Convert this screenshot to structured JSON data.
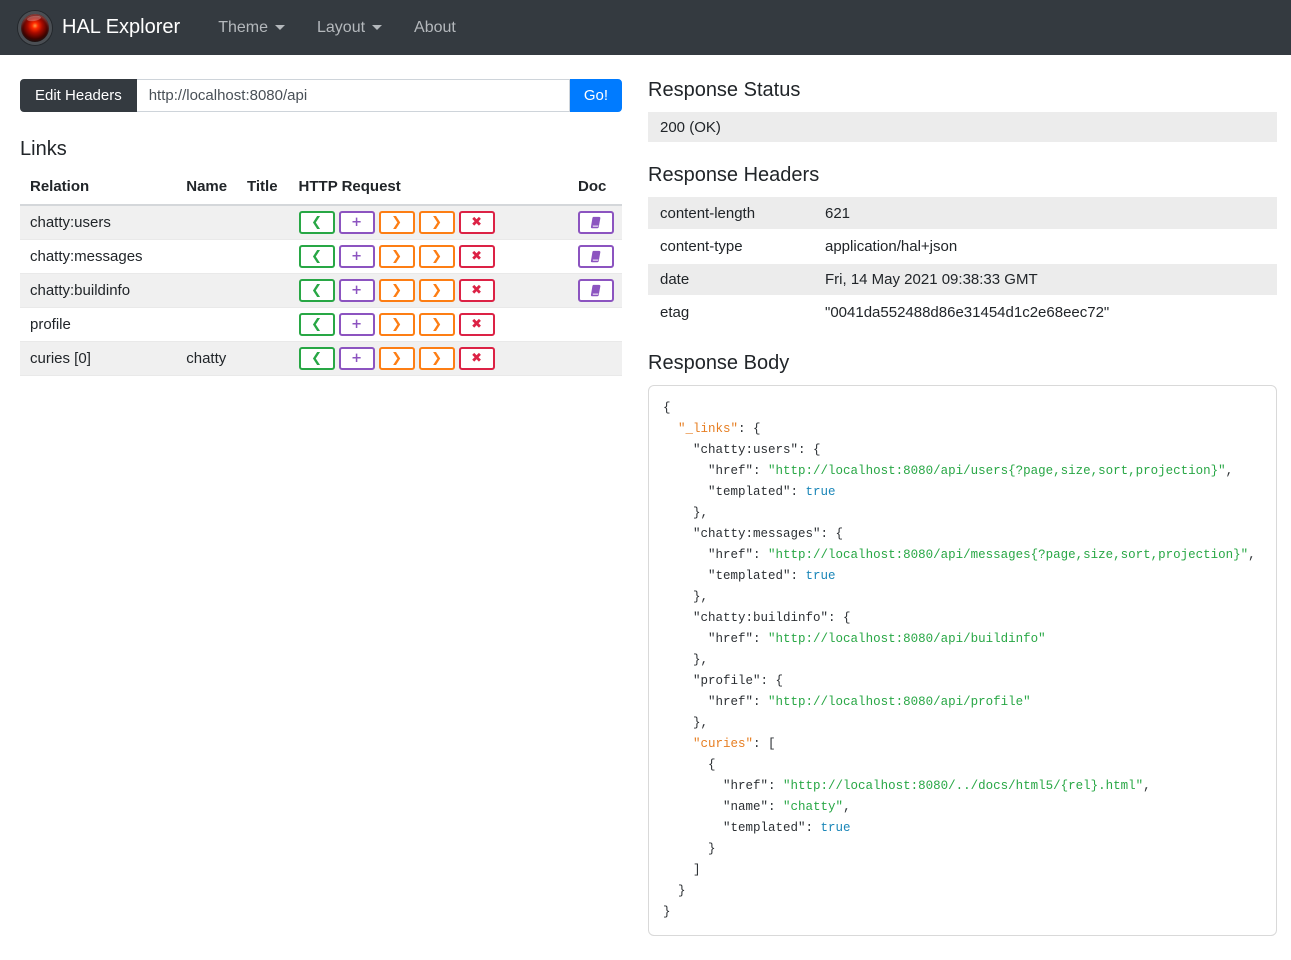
{
  "navbar": {
    "brand": "HAL Explorer",
    "items": [
      {
        "label": "Theme",
        "dropdown": true
      },
      {
        "label": "Layout",
        "dropdown": true
      },
      {
        "label": "About",
        "dropdown": false
      }
    ]
  },
  "address_bar": {
    "edit_headers_label": "Edit Headers",
    "url_value": "http://localhost:8080/api",
    "go_label": "Go!"
  },
  "links_section": {
    "title": "Links",
    "columns": [
      "Relation",
      "Name",
      "Title",
      "HTTP Request",
      "Doc"
    ],
    "http_request_buttons": [
      {
        "method": "get",
        "glyph": "❮",
        "color": "#28a745"
      },
      {
        "method": "post",
        "glyph": "+",
        "color": "#8c54c0"
      },
      {
        "method": "put",
        "glyph": "❯",
        "color": "#fd7e14"
      },
      {
        "method": "patch",
        "glyph": "❯",
        "color": "#fd7e14"
      },
      {
        "method": "delete",
        "glyph": "✖",
        "color": "#dc2245"
      }
    ],
    "doc_button_color": "#8c54c0",
    "rows": [
      {
        "relation": "chatty:users",
        "name": "",
        "title": "",
        "doc": true
      },
      {
        "relation": "chatty:messages",
        "name": "",
        "title": "",
        "doc": true
      },
      {
        "relation": "chatty:buildinfo",
        "name": "",
        "title": "",
        "doc": true
      },
      {
        "relation": "profile",
        "name": "",
        "title": "",
        "doc": false
      },
      {
        "relation": "curies [0]",
        "name": "chatty",
        "title": "",
        "doc": false
      }
    ]
  },
  "response_status": {
    "title": "Response Status",
    "value": "200 (OK)"
  },
  "response_headers": {
    "title": "Response Headers",
    "rows": [
      {
        "key": "content-length",
        "value": "621"
      },
      {
        "key": "content-type",
        "value": "application/hal+json"
      },
      {
        "key": "date",
        "value": "Fri, 14 May 2021 09:38:33 GMT"
      },
      {
        "key": "etag",
        "value": "\"0041da552488d86e31454d1c2e68eec72\""
      }
    ]
  },
  "response_body": {
    "title": "Response Body",
    "syntax_colors": {
      "key": "#2b2f33",
      "hal_key": "#e67e22",
      "string": "#28a745",
      "literal": "#1a86b8"
    },
    "lines": [
      {
        "i": 0,
        "t": [
          [
            "p",
            "{"
          ]
        ]
      },
      {
        "i": 2,
        "t": [
          [
            "h",
            "\"_links\""
          ],
          [
            "p",
            ": {"
          ]
        ]
      },
      {
        "i": 4,
        "t": [
          [
            "k",
            "\"chatty:users\""
          ],
          [
            "p",
            ": {"
          ]
        ]
      },
      {
        "i": 6,
        "t": [
          [
            "k",
            "\"href\""
          ],
          [
            "p",
            ": "
          ],
          [
            "s",
            "\"http://localhost:8080/api/users{?page,size,sort,projection}\""
          ],
          [
            "p",
            ","
          ]
        ]
      },
      {
        "i": 6,
        "t": [
          [
            "k",
            "\"templated\""
          ],
          [
            "p",
            ": "
          ],
          [
            "b",
            "true"
          ]
        ]
      },
      {
        "i": 4,
        "t": [
          [
            "p",
            "},"
          ]
        ]
      },
      {
        "i": 4,
        "t": [
          [
            "k",
            "\"chatty:messages\""
          ],
          [
            "p",
            ": {"
          ]
        ]
      },
      {
        "i": 6,
        "t": [
          [
            "k",
            "\"href\""
          ],
          [
            "p",
            ": "
          ],
          [
            "s",
            "\"http://localhost:8080/api/messages{?page,size,sort,projection}\""
          ],
          [
            "p",
            ","
          ]
        ]
      },
      {
        "i": 6,
        "t": [
          [
            "k",
            "\"templated\""
          ],
          [
            "p",
            ": "
          ],
          [
            "b",
            "true"
          ]
        ]
      },
      {
        "i": 4,
        "t": [
          [
            "p",
            "},"
          ]
        ]
      },
      {
        "i": 4,
        "t": [
          [
            "k",
            "\"chatty:buildinfo\""
          ],
          [
            "p",
            ": {"
          ]
        ]
      },
      {
        "i": 6,
        "t": [
          [
            "k",
            "\"href\""
          ],
          [
            "p",
            ": "
          ],
          [
            "s",
            "\"http://localhost:8080/api/buildinfo\""
          ]
        ]
      },
      {
        "i": 4,
        "t": [
          [
            "p",
            "},"
          ]
        ]
      },
      {
        "i": 4,
        "t": [
          [
            "k",
            "\"profile\""
          ],
          [
            "p",
            ": {"
          ]
        ]
      },
      {
        "i": 6,
        "t": [
          [
            "k",
            "\"href\""
          ],
          [
            "p",
            ": "
          ],
          [
            "s",
            "\"http://localhost:8080/api/profile\""
          ]
        ]
      },
      {
        "i": 4,
        "t": [
          [
            "p",
            "},"
          ]
        ]
      },
      {
        "i": 4,
        "t": [
          [
            "h",
            "\"curies\""
          ],
          [
            "p",
            ": ["
          ]
        ]
      },
      {
        "i": 6,
        "t": [
          [
            "p",
            "{"
          ]
        ]
      },
      {
        "i": 8,
        "t": [
          [
            "k",
            "\"href\""
          ],
          [
            "p",
            ": "
          ],
          [
            "s",
            "\"http://localhost:8080/../docs/html5/{rel}.html\""
          ],
          [
            "p",
            ","
          ]
        ]
      },
      {
        "i": 8,
        "t": [
          [
            "k",
            "\"name\""
          ],
          [
            "p",
            ": "
          ],
          [
            "s",
            "\"chatty\""
          ],
          [
            "p",
            ","
          ]
        ]
      },
      {
        "i": 8,
        "t": [
          [
            "k",
            "\"templated\""
          ],
          [
            "p",
            ": "
          ],
          [
            "b",
            "true"
          ]
        ]
      },
      {
        "i": 6,
        "t": [
          [
            "p",
            "}"
          ]
        ]
      },
      {
        "i": 4,
        "t": [
          [
            "p",
            "]"
          ]
        ]
      },
      {
        "i": 2,
        "t": [
          [
            "p",
            "}"
          ]
        ]
      },
      {
        "i": 0,
        "t": [
          [
            "p",
            "}"
          ]
        ]
      }
    ]
  }
}
